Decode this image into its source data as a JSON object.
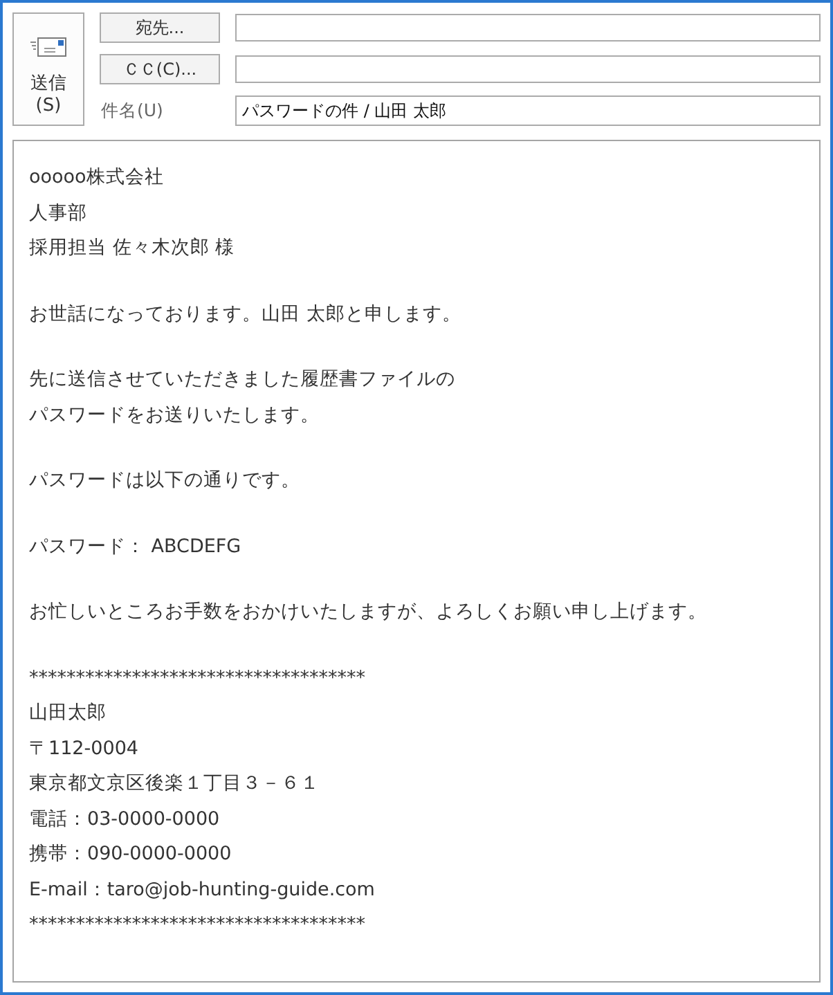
{
  "send_button": {
    "label": "送信",
    "shortcut": "(S)"
  },
  "to_button": {
    "label": "宛先..."
  },
  "cc_button": {
    "label": "ＣＣ(C)..."
  },
  "subject": {
    "label": "件名(U)",
    "value": "パスワードの件 / 山田 太郎"
  },
  "body": {
    "paragraphs": [
      [
        "ooooo株式会社",
        "人事部",
        "採用担当 佐々木次郎 様"
      ],
      [
        "お世話になっております。山田 太郎と申します。"
      ],
      [
        "先に送信させていただきました履歴書ファイルの",
        "パスワードをお送りいたします。"
      ],
      [
        "パスワードは以下の通りです。"
      ],
      [
        "パスワード： ABCDEFG"
      ],
      [
        "お忙しいところお手数をおかけいたしますが、よろしくお願い申し上げます。"
      ],
      [
        "************************************",
        "山田太郎",
        "〒112-0004",
        "東京都文京区後楽１丁目３－６１",
        "電話：03-0000-0000",
        "携帯：090-0000-0000",
        "E-mail：taro@job-hunting-guide.com",
        "************************************"
      ]
    ]
  }
}
